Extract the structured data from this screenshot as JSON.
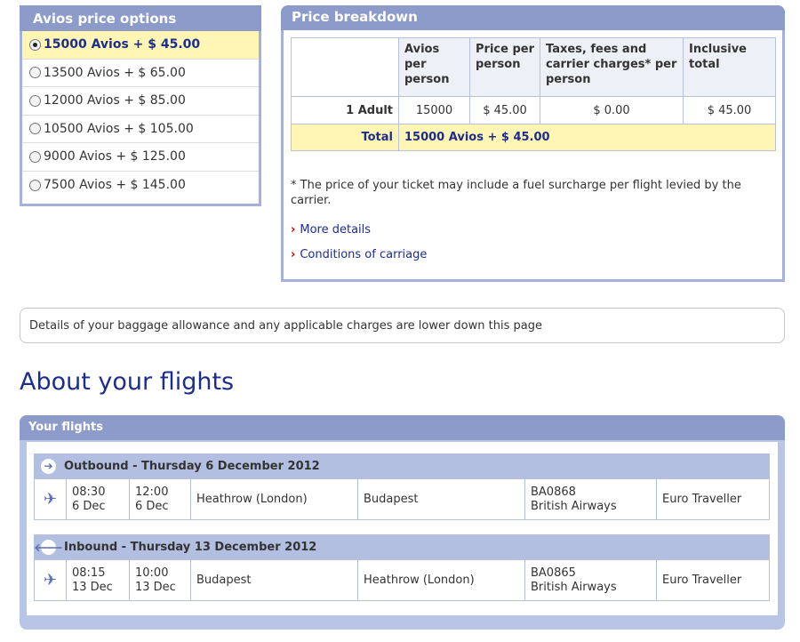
{
  "avios_options": {
    "title": "Avios price options",
    "options": [
      {
        "label": "15000 Avios + $ 45.00",
        "selected": true
      },
      {
        "label": "13500 Avios + $ 65.00",
        "selected": false
      },
      {
        "label": "12000 Avios + $ 85.00",
        "selected": false
      },
      {
        "label": "10500 Avios + $ 105.00",
        "selected": false
      },
      {
        "label": "9000 Avios + $ 125.00",
        "selected": false
      },
      {
        "label": "7500 Avios + $ 145.00",
        "selected": false
      }
    ]
  },
  "price_breakdown": {
    "title": "Price breakdown",
    "headers": [
      "Avios per person",
      "Price per person",
      "Taxes, fees and carrier charges* per person",
      "Inclusive total"
    ],
    "row": {
      "label": "1 Adult",
      "avios": "15000",
      "price": "$ 45.00",
      "taxes": "$ 0.00",
      "total": "$ 45.00"
    },
    "total_label": "Total",
    "total_value": "15000 Avios + $ 45.00",
    "note": "* The price of your ticket may include a fuel surcharge per flight levied by the carrier.",
    "links": {
      "more_details": "More details",
      "conditions": "Conditions of carriage"
    }
  },
  "baggage_notice": "Details of your baggage allowance and any applicable charges are lower down this page",
  "about_title": "About your flights",
  "flights": {
    "title": "Your flights",
    "outbound": {
      "heading": "Outbound - Thursday 6 December 2012",
      "depart_time": "08:30",
      "depart_date": "6 Dec",
      "arrive_time": "12:00",
      "arrive_date": "6 Dec",
      "from": "Heathrow (London)",
      "to": "Budapest",
      "flight_no": "BA0868",
      "airline": "British Airways",
      "cabin": "Euro Traveller"
    },
    "inbound": {
      "heading": "Inbound - Thursday 13 December 2012",
      "depart_time": "08:15",
      "depart_date": "13 Dec",
      "arrive_time": "10:00",
      "arrive_date": "13 Dec",
      "from": "Budapest",
      "to": "Heathrow (London)",
      "flight_no": "BA0865",
      "airline": "British Airways",
      "cabin": "Euro Traveller"
    }
  },
  "icons": {
    "outbound": "arrow-right-icon",
    "inbound": "arrow-left-icon",
    "plane": "plane-icon",
    "link_chevron": "chevron-right-icon"
  },
  "colors": {
    "accent": "#1d2d8c",
    "header": "#8c9bc9",
    "highlight": "#fff6b5",
    "link_chevron": "#c00000"
  }
}
